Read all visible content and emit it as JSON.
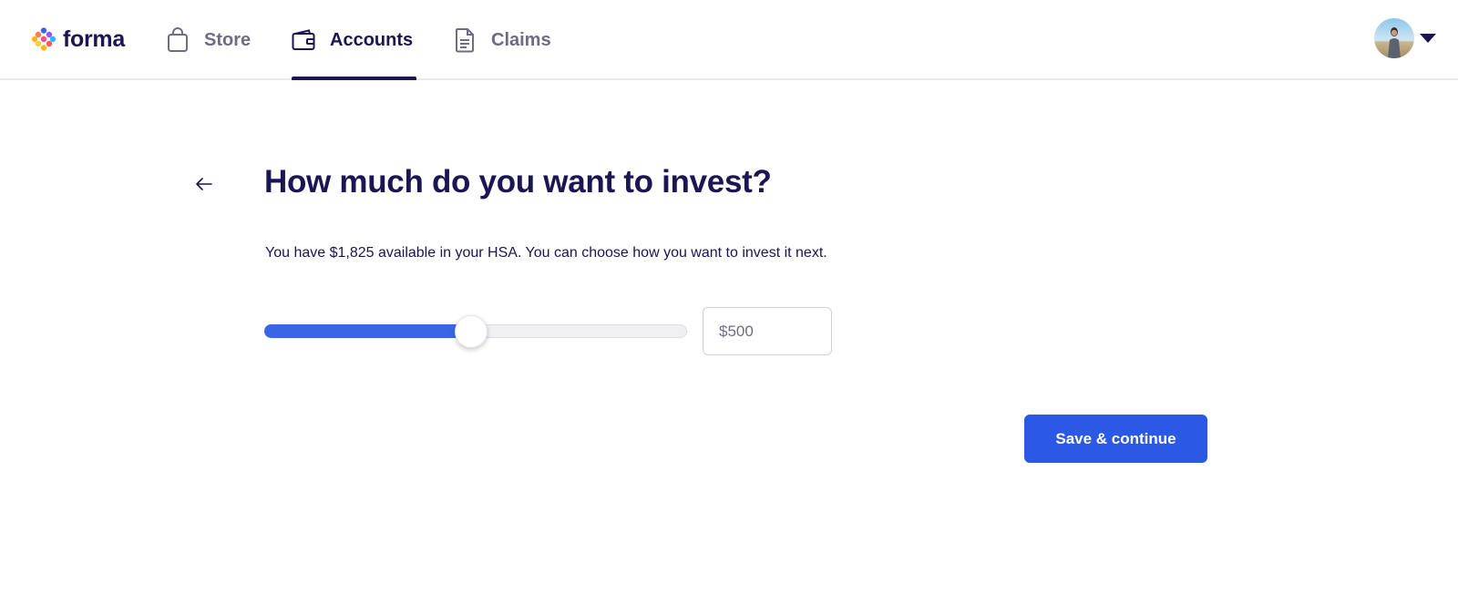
{
  "app": {
    "logo_text": "forma",
    "logo_icon": "forma-flower-logo"
  },
  "nav": {
    "items": [
      {
        "label": "Store",
        "icon": "shopping-bag-icon",
        "active": false
      },
      {
        "label": "Accounts",
        "icon": "wallet-icon",
        "active": true
      },
      {
        "label": "Claims",
        "icon": "document-icon",
        "active": false
      }
    ]
  },
  "user": {
    "avatar": "user-avatar-photo",
    "menu_icon": "caret-down-icon"
  },
  "page": {
    "back_icon": "arrow-left-icon",
    "title": "How much do you want to invest?",
    "description": "You have $1,825 available in your HSA. You can choose how you want to invest it next."
  },
  "investment": {
    "slider_fraction": 0.49,
    "amount_placeholder": "$500",
    "amount_value": ""
  },
  "actions": {
    "save_label": "Save & continue"
  },
  "colors": {
    "primary": "#2c59e3",
    "slider_fill": "#3a66e6",
    "text_dark": "#1b1553",
    "text_muted": "#6e6b85"
  }
}
